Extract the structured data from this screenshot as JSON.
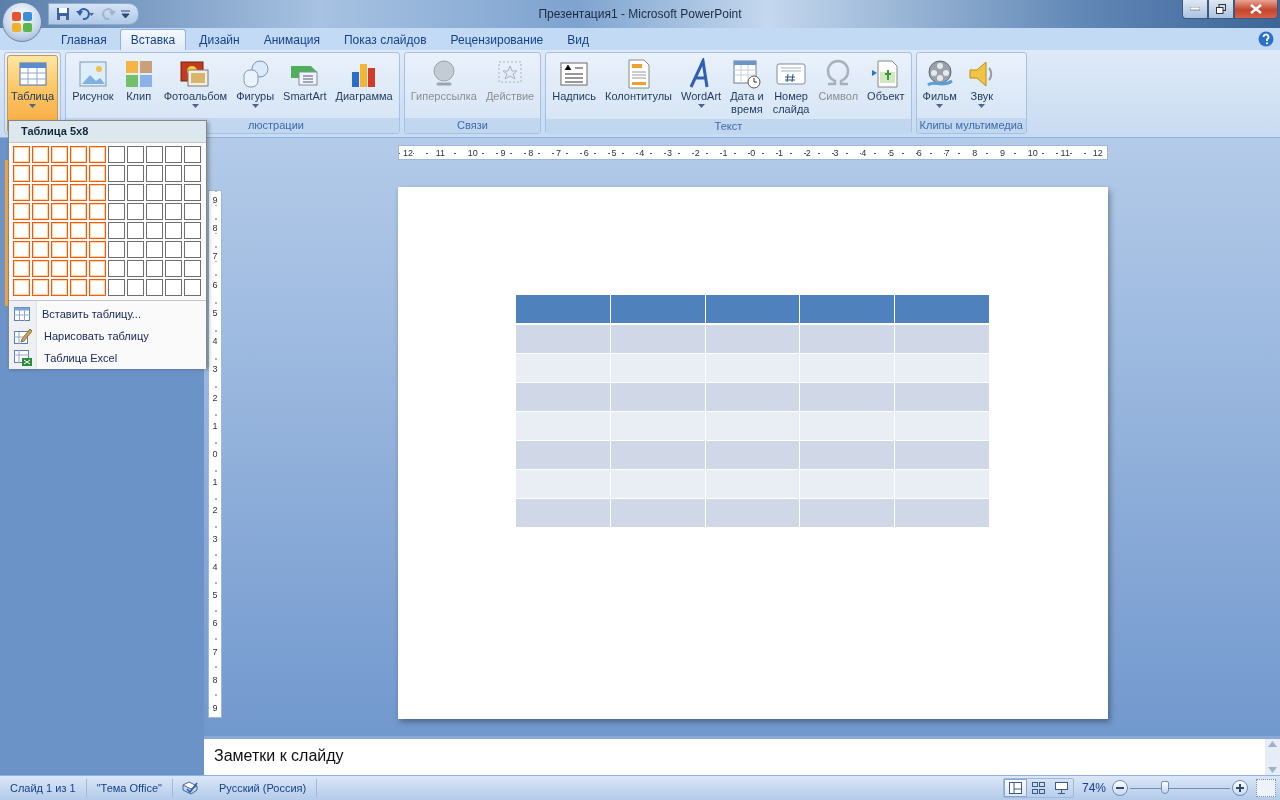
{
  "window": {
    "title": "Презентация1 - Microsoft PowerPoint"
  },
  "quick_access": [
    {
      "kind": "save",
      "disabled": false
    },
    {
      "kind": "undo",
      "disabled": false
    },
    {
      "kind": "redo",
      "disabled": true
    }
  ],
  "tabs": [
    {
      "label": "Главная",
      "selected": false
    },
    {
      "label": "Вставка",
      "selected": true
    },
    {
      "label": "Дизайн",
      "selected": false
    },
    {
      "label": "Анимация",
      "selected": false
    },
    {
      "label": "Показ слайдов",
      "selected": false
    },
    {
      "label": "Рецензирование",
      "selected": false
    },
    {
      "label": "Вид",
      "selected": false
    }
  ],
  "ribbon": {
    "groups": [
      {
        "buttons": [
          {
            "label": "Таблица",
            "selected": true,
            "disabled": false,
            "menu": true
          }
        ]
      },
      {
        "label": "люстрации",
        "buttons": [
          {
            "label": "Рисунок",
            "selected": false,
            "disabled": false,
            "menu": false
          },
          {
            "label": "Клип",
            "selected": false,
            "disabled": false,
            "menu": false
          },
          {
            "label": "Фотоальбом",
            "selected": false,
            "disabled": false,
            "menu": true
          },
          {
            "label": "Фигуры",
            "selected": false,
            "disabled": false,
            "menu": true
          },
          {
            "label": "SmartArt",
            "selected": false,
            "disabled": false,
            "menu": false
          },
          {
            "label": "Диаграмма",
            "selected": false,
            "disabled": false,
            "menu": false
          }
        ]
      },
      {
        "label": "Связи",
        "buttons": [
          {
            "label": "Гиперссылка",
            "selected": false,
            "disabled": true,
            "menu": false
          },
          {
            "label": "Действие",
            "selected": false,
            "disabled": true,
            "menu": false
          }
        ]
      },
      {
        "label": "Текст",
        "buttons": [
          {
            "label": "Надпись",
            "selected": false,
            "disabled": false,
            "menu": false
          },
          {
            "label": "Колонтитулы",
            "selected": false,
            "disabled": false,
            "menu": false
          },
          {
            "label": "WordArt",
            "selected": false,
            "disabled": false,
            "menu": true
          },
          {
            "label": "Дата и\nвремя",
            "selected": false,
            "disabled": false,
            "menu": false
          },
          {
            "label": "Номер\nслайда",
            "selected": false,
            "disabled": false,
            "menu": false
          },
          {
            "label": "Символ",
            "selected": false,
            "disabled": true,
            "menu": false
          },
          {
            "label": "Объект",
            "selected": false,
            "disabled": false,
            "menu": false
          }
        ]
      },
      {
        "label": "Клипы мультимедиа",
        "buttons": [
          {
            "label": "Фильм",
            "selected": false,
            "disabled": false,
            "menu": true
          },
          {
            "label": "Звук",
            "selected": false,
            "disabled": false,
            "menu": true
          }
        ]
      }
    ]
  },
  "table_menu": {
    "title": "Таблица 5x8",
    "grid": [
      {
        "cells": [
          {
            "selected": true
          },
          {
            "selected": true
          },
          {
            "selected": true
          },
          {
            "selected": true
          },
          {
            "selected": true
          },
          {
            "selected": false
          },
          {
            "selected": false
          },
          {
            "selected": false
          },
          {
            "selected": false
          },
          {
            "selected": false
          }
        ]
      },
      {
        "cells": [
          {
            "selected": true
          },
          {
            "selected": true
          },
          {
            "selected": true
          },
          {
            "selected": true
          },
          {
            "selected": true
          },
          {
            "selected": false
          },
          {
            "selected": false
          },
          {
            "selected": false
          },
          {
            "selected": false
          },
          {
            "selected": false
          }
        ]
      },
      {
        "cells": [
          {
            "selected": true
          },
          {
            "selected": true
          },
          {
            "selected": true
          },
          {
            "selected": true
          },
          {
            "selected": true
          },
          {
            "selected": false
          },
          {
            "selected": false
          },
          {
            "selected": false
          },
          {
            "selected": false
          },
          {
            "selected": false
          }
        ]
      },
      {
        "cells": [
          {
            "selected": true
          },
          {
            "selected": true
          },
          {
            "selected": true
          },
          {
            "selected": true
          },
          {
            "selected": true
          },
          {
            "selected": false
          },
          {
            "selected": false
          },
          {
            "selected": false
          },
          {
            "selected": false
          },
          {
            "selected": false
          }
        ]
      },
      {
        "cells": [
          {
            "selected": true
          },
          {
            "selected": true
          },
          {
            "selected": true
          },
          {
            "selected": true
          },
          {
            "selected": true
          },
          {
            "selected": false
          },
          {
            "selected": false
          },
          {
            "selected": false
          },
          {
            "selected": false
          },
          {
            "selected": false
          }
        ]
      },
      {
        "cells": [
          {
            "selected": true
          },
          {
            "selected": true
          },
          {
            "selected": true
          },
          {
            "selected": true
          },
          {
            "selected": true
          },
          {
            "selected": false
          },
          {
            "selected": false
          },
          {
            "selected": false
          },
          {
            "selected": false
          },
          {
            "selected": false
          }
        ]
      },
      {
        "cells": [
          {
            "selected": true
          },
          {
            "selected": true
          },
          {
            "selected": true
          },
          {
            "selected": true
          },
          {
            "selected": true
          },
          {
            "selected": false
          },
          {
            "selected": false
          },
          {
            "selected": false
          },
          {
            "selected": false
          },
          {
            "selected": false
          }
        ]
      },
      {
        "cells": [
          {
            "selected": true
          },
          {
            "selected": true
          },
          {
            "selected": true
          },
          {
            "selected": true
          },
          {
            "selected": true
          },
          {
            "selected": false
          },
          {
            "selected": false
          },
          {
            "selected": false
          },
          {
            "selected": false
          },
          {
            "selected": false
          }
        ]
      }
    ],
    "items": [
      {
        "kind": "insert",
        "label": "Вставить таблицу..."
      },
      {
        "kind": "draw",
        "label": "Нарисовать таблицу"
      },
      {
        "kind": "excel",
        "label": "Таблица Excel"
      }
    ]
  },
  "rulers": {
    "horizontal": [
      "12",
      "11",
      "10",
      "9",
      "8",
      "7",
      "6",
      "5",
      "4",
      "3",
      "2",
      "1",
      "0",
      "1",
      "2",
      "3",
      "4",
      "5",
      "6",
      "7",
      "8",
      "9",
      "10",
      "11",
      "12"
    ],
    "vertical": [
      "9",
      "8",
      "7",
      "6",
      "5",
      "4",
      "3",
      "2",
      "1",
      "0",
      "1",
      "2",
      "3",
      "4",
      "5",
      "6",
      "7",
      "8",
      "9"
    ]
  },
  "slide": {
    "table": {
      "rows": [
        {
          "kind": "header"
        },
        {
          "kind": "dark"
        },
        {
          "kind": "light"
        },
        {
          "kind": "dark"
        },
        {
          "kind": "light"
        },
        {
          "kind": "dark"
        },
        {
          "kind": "light"
        },
        {
          "kind": "dark"
        }
      ]
    }
  },
  "notes": {
    "text": "Заметки к слайду"
  },
  "status_bar": {
    "slide": "Слайд 1 из 1",
    "theme": "\"Тема Office\"",
    "language": "Русский (Россия)",
    "views": [
      {
        "kind": "normal",
        "selected": true
      },
      {
        "kind": "sorter",
        "selected": false
      },
      {
        "kind": "show",
        "selected": false
      }
    ],
    "zoom": "74%",
    "zoom_slider": {
      "level": 0.35
    }
  }
}
